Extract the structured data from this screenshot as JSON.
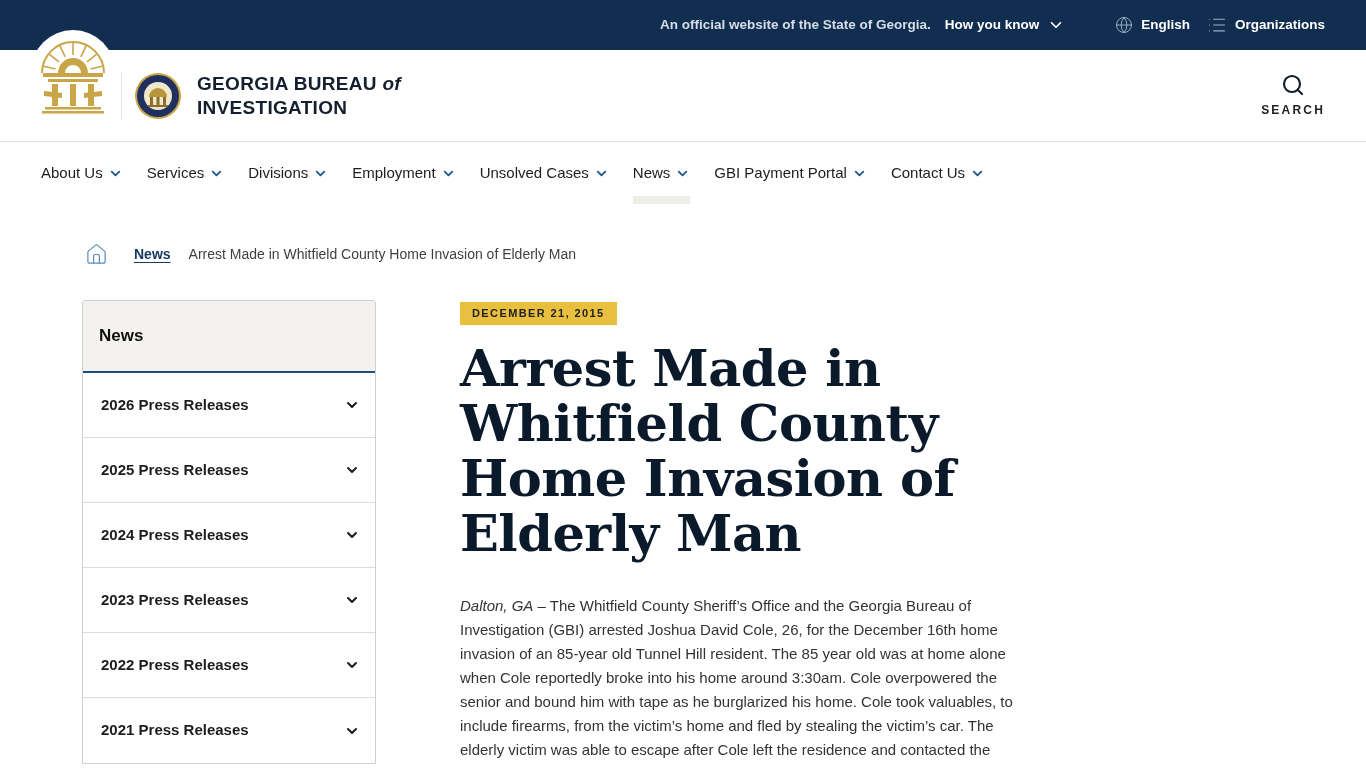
{
  "official_banner": {
    "notice": "An official website of the State of Georgia.",
    "how_you_know": "How you know",
    "language": "English",
    "organizations": "Organizations"
  },
  "header": {
    "site_name": {
      "line_1": "GEORGIA BUREAU *of*",
      "line_2": "INVESTIGATION"
    },
    "search_label": "SEARCH"
  },
  "nav": [
    {
      "label": "About Us",
      "selected": false
    },
    {
      "label": "Services",
      "selected": false
    },
    {
      "label": "Divisions",
      "selected": false
    },
    {
      "label": "Employment",
      "selected": false
    },
    {
      "label": "Unsolved Cases",
      "selected": false
    },
    {
      "label": "News",
      "selected": true
    },
    {
      "label": "GBI Payment Portal",
      "selected": false
    },
    {
      "label": "Contact Us",
      "selected": false
    }
  ],
  "breadcrumb": [
    {
      "kind": "link",
      "label": "News"
    },
    {
      "kind": "current",
      "label": "Arrest Made in Whitfield County Home Invasion of Elderly Man"
    }
  ],
  "sidebar": {
    "title": "News",
    "items": [
      {
        "label": "2026 Press Releases",
        "expanded": false
      },
      {
        "label": "2025 Press Releases",
        "expanded": false
      },
      {
        "label": "2024 Press Releases",
        "expanded": false
      },
      {
        "label": "2023 Press Releases",
        "expanded": false
      },
      {
        "label": "2022 Press Releases",
        "expanded": false
      },
      {
        "label": "2021 Press Releases",
        "expanded": false
      }
    ]
  },
  "article": {
    "date": "DECEMBER 21, 2015",
    "title": "Arrest Made in Whitfield County Home Invasion of Elderly Man",
    "body": "*Dalton, GA* – The Whitfield County Sheriff’s Office and the Georgia Bureau of Investigation (GBI) arrested Joshua David Cole, 26, for the December 16th home invasion of an 85-year old Tunnel Hill resident. The 85 year old was at home alone when Cole reportedly broke into his home around 3:30am. Cole overpowered the senior and bound him with tape as he burglarized his home. Cole took valuables, to include firearms, from the victim’s home and fled by stealing the victim’s car. The elderly victim was able to escape after Cole left the residence and contacted the"
  }
}
